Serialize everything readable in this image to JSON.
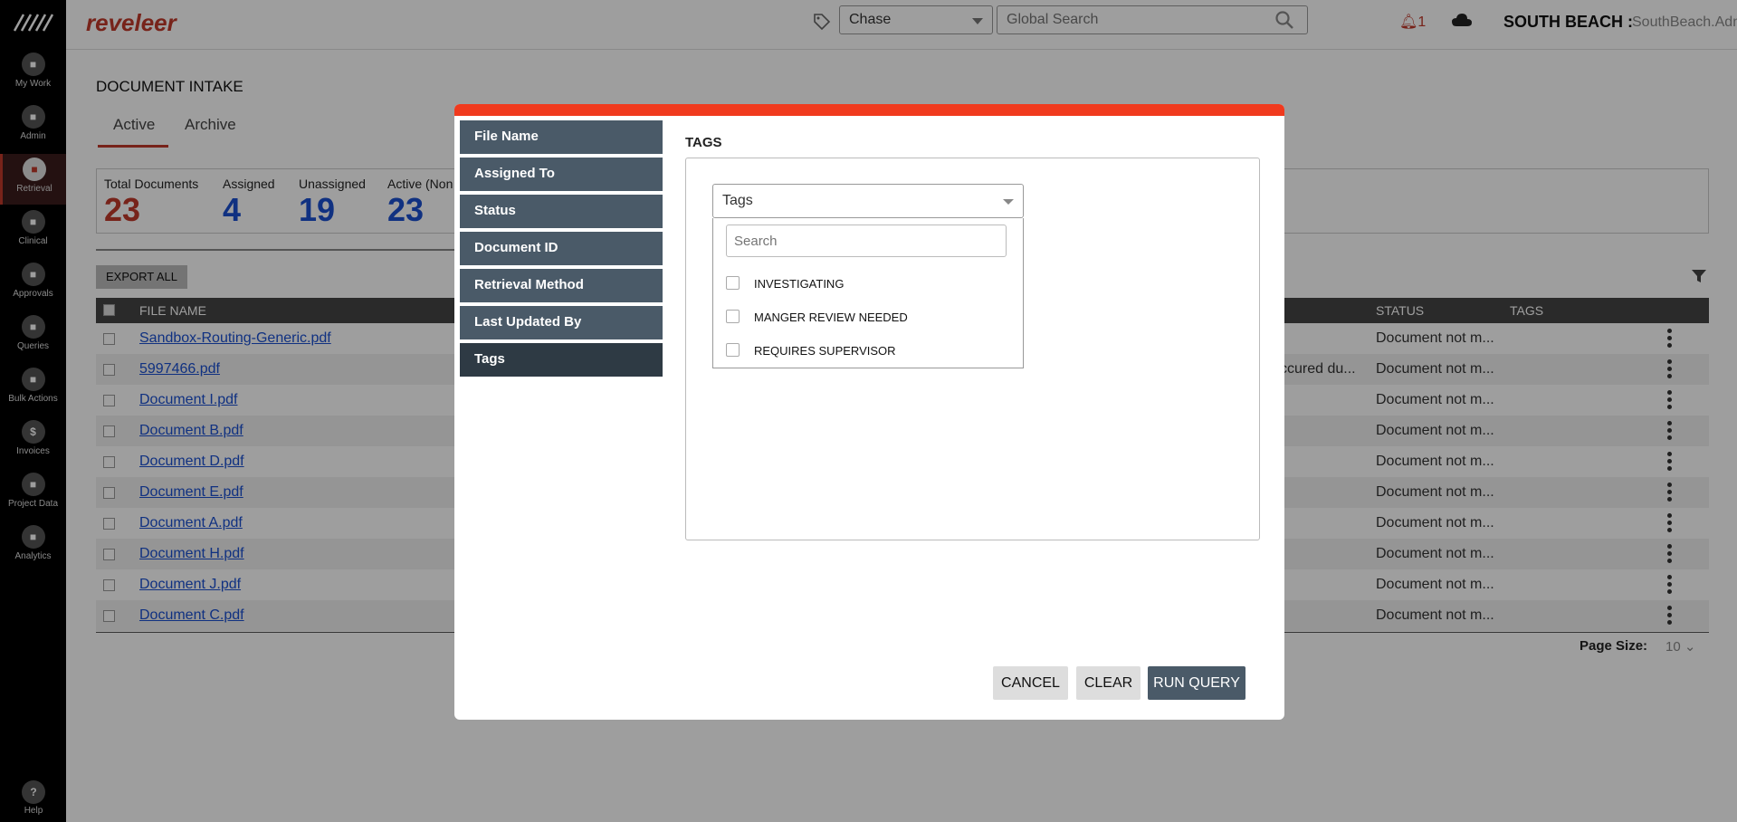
{
  "app": {
    "brand": "reveleer"
  },
  "sidebar": {
    "items": [
      {
        "label": "My Work",
        "icon": "home-icon"
      },
      {
        "label": "Admin",
        "icon": "admin-icon"
      },
      {
        "label": "Retrieval",
        "icon": "retrieval-icon",
        "active": true
      },
      {
        "label": "Clinical",
        "icon": "clinical-icon"
      },
      {
        "label": "Approvals",
        "icon": "approvals-icon"
      },
      {
        "label": "Queries",
        "icon": "queries-icon"
      },
      {
        "label": "Bulk Actions",
        "icon": "layers-icon"
      },
      {
        "label": "Invoices",
        "icon": "dollar-icon",
        "glyph": "$"
      },
      {
        "label": "Project Data",
        "icon": "project-data-icon"
      },
      {
        "label": "Analytics",
        "icon": "analytics-icon"
      }
    ],
    "help": {
      "label": "Help",
      "glyph": "?"
    }
  },
  "header": {
    "project_select": "Chase",
    "global_search_placeholder": "Global Search",
    "notification_count": "1",
    "org": "SOUTH BEACH :",
    "user": "SouthBeach.Admin"
  },
  "page": {
    "title": "DOCUMENT INTAKE",
    "tabs": [
      "Active",
      "Archive"
    ],
    "stats": [
      {
        "label": "Total Documents",
        "value": "23",
        "color": "#c0392b"
      },
      {
        "label": "Assigned",
        "value": "4",
        "color": "#1a4fd0"
      },
      {
        "label": "Unassigned",
        "value": "19",
        "color": "#1a4fd0"
      },
      {
        "label": "Active (Non",
        "value": "23",
        "color": "#1a4fd0"
      }
    ],
    "export_label": "EXPORT ALL",
    "table": {
      "headers": {
        "file_name": "FILE NAME",
        "status": "STATUS",
        "tags": "TAGS"
      },
      "rows": [
        {
          "file": "Sandbox-Routing-Generic.pdf",
          "status": "Document not m...",
          "note": ""
        },
        {
          "file": "5997466.pdf",
          "status": "Document not m...",
          "note": "ccured du..."
        },
        {
          "file": "Document I.pdf",
          "status": "Document not m...",
          "note": ""
        },
        {
          "file": "Document B.pdf",
          "status": "Document not m...",
          "note": ""
        },
        {
          "file": "Document D.pdf",
          "status": "Document not m...",
          "note": ""
        },
        {
          "file": "Document E.pdf",
          "status": "Document not m...",
          "note": ""
        },
        {
          "file": "Document A.pdf",
          "status": "Document not m...",
          "note": ""
        },
        {
          "file": "Document H.pdf",
          "status": "Document not m...",
          "note": ""
        },
        {
          "file": "Document J.pdf",
          "status": "Document not m...",
          "note": ""
        },
        {
          "file": "Document C.pdf",
          "status": "Document not m...",
          "note": ""
        }
      ]
    },
    "page_size_label": "Page Size:",
    "page_size": "10"
  },
  "modal": {
    "menu": [
      "File Name",
      "Assigned To",
      "Status",
      "Document ID",
      "Retrieval Method",
      "Last Updated By",
      "Tags"
    ],
    "selected_menu": "Tags",
    "section_title": "TAGS",
    "tags_select": "Tags",
    "dropdown_search_placeholder": "Search",
    "options": [
      "INVESTIGATING",
      "MANGER REVIEW NEEDED",
      "REQUIRES SUPERVISOR"
    ],
    "buttons": {
      "cancel": "CANCEL",
      "clear": "CLEAR",
      "run": "RUN QUERY"
    },
    "accent": "#f03a1e"
  }
}
